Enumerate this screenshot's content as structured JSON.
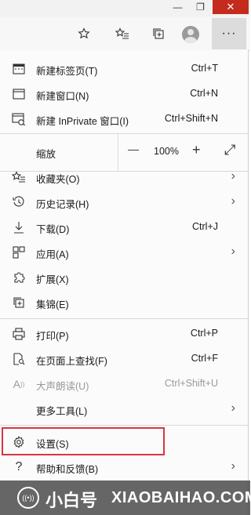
{
  "window": {
    "minimize_glyph": "—",
    "maximize_glyph": "❐",
    "close_glyph": "✕"
  },
  "toolbar": {
    "more_glyph": "···"
  },
  "menu": {
    "items_top": [
      {
        "label": "新建标签页(T)",
        "shortcut": "Ctrl+T",
        "icon": "new-tab-icon"
      },
      {
        "label": "新建窗口(N)",
        "shortcut": "Ctrl+N",
        "icon": "new-window-icon"
      },
      {
        "label": "新建 InPrivate 窗口(I)",
        "shortcut": "Ctrl+Shift+N",
        "icon": "inprivate-icon"
      }
    ],
    "zoom": {
      "label": "缩放",
      "minus": "—",
      "value": "100%",
      "plus": "+",
      "fullscreen": "⤢"
    },
    "items_mid": [
      {
        "label": "收藏夹(O)",
        "icon": "favorites-icon",
        "arrow": "›"
      },
      {
        "label": "历史记录(H)",
        "icon": "history-icon",
        "arrow": "›"
      },
      {
        "label": "下载(D)",
        "shortcut": "Ctrl+J",
        "icon": "download-icon"
      },
      {
        "label": "应用(A)",
        "icon": "apps-icon",
        "arrow": "›"
      },
      {
        "label": "扩展(X)",
        "icon": "extensions-icon"
      },
      {
        "label": "集锦(E)",
        "icon": "collections-icon"
      }
    ],
    "items_bottom": [
      {
        "label": "打印(P)",
        "shortcut": "Ctrl+P",
        "icon": "print-icon"
      },
      {
        "label": "在页面上查找(F)",
        "shortcut": "Ctrl+F",
        "icon": "find-icon"
      },
      {
        "label": "大声朗读(U)",
        "shortcut": "Ctrl+Shift+U",
        "icon": "read-aloud-icon"
      },
      {
        "label": "更多工具(L)",
        "arrow": "›"
      }
    ],
    "items_end": [
      {
        "label": "设置(S)",
        "icon": "gear-icon"
      },
      {
        "label": "帮助和反馈(B)",
        "icon": "help-icon",
        "arrow": "›"
      }
    ]
  },
  "watermark": {
    "icon_glyph": "((•))",
    "cn": "小白号",
    "en": "XIAOBAIHAO.COM"
  },
  "colors": {
    "highlight_border": "#d9343f",
    "close_button": "#c42b1c"
  }
}
